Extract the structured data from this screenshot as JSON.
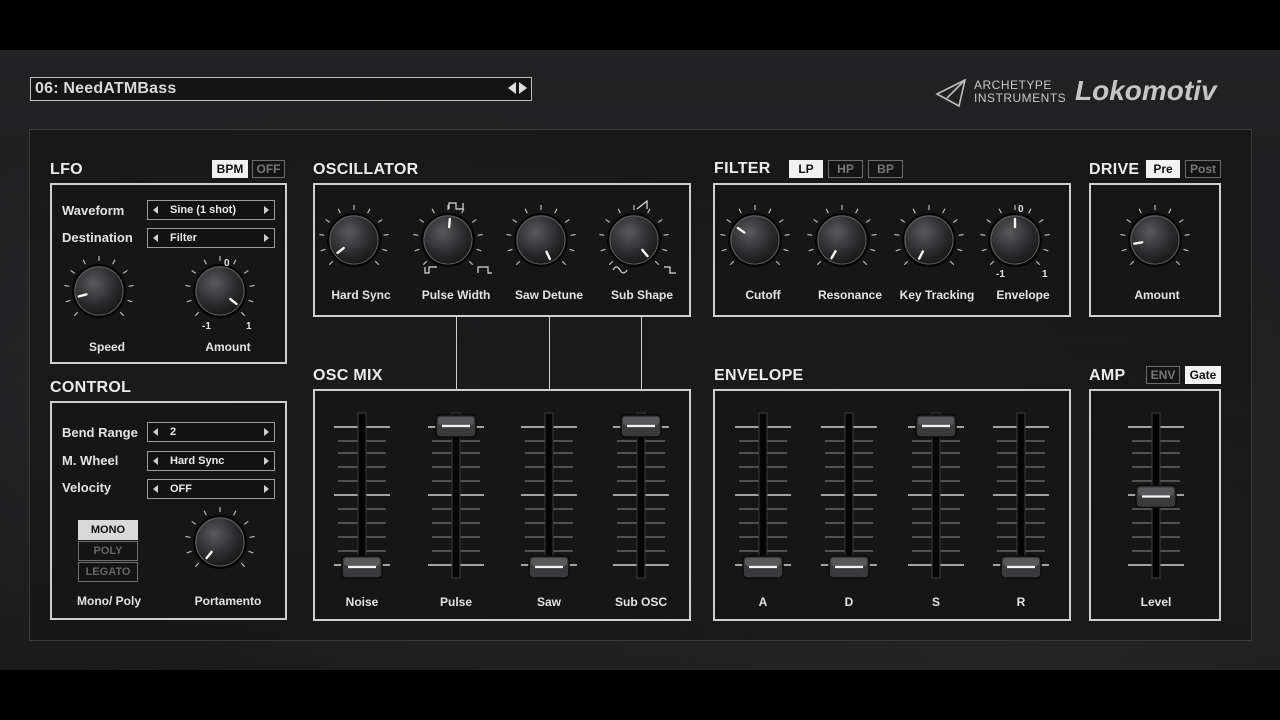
{
  "preset": {
    "name": "06: NeedATMBass"
  },
  "brand": {
    "line1": "ARCHETYPE",
    "line2": "INSTRUMENTS",
    "product": "Lokomotiv"
  },
  "lfo": {
    "title": "LFO",
    "toggles": [
      "BPM",
      "OFF"
    ],
    "waveform_label": "Waveform",
    "waveform_value": "Sine (1 shot)",
    "destination_label": "Destination",
    "destination_value": "Filter",
    "speed_label": "Speed",
    "amount_label": "Amount",
    "amount_top": "0",
    "amount_min": "-1",
    "amount_max": "1"
  },
  "control": {
    "title": "CONTROL",
    "bend_label": "Bend Range",
    "bend_value": "2",
    "wheel_label": "M. Wheel",
    "wheel_value": "Hard Sync",
    "velocity_label": "Velocity",
    "velocity_value": "OFF",
    "modes": [
      "MONO",
      "POLY",
      "LEGATO"
    ],
    "mono_poly_label": "Mono/ Poly",
    "portamento_label": "Portamento"
  },
  "oscillator": {
    "title": "OSCILLATOR",
    "knobs": [
      "Hard Sync",
      "Pulse Width",
      "Saw Detune",
      "Sub Shape"
    ]
  },
  "filter": {
    "title": "FILTER",
    "toggles": [
      "LP",
      "HP",
      "BP"
    ],
    "knobs": [
      "Cutoff",
      "Resonance",
      "Key Tracking",
      "Envelope"
    ],
    "env_top": "0",
    "env_min": "-1",
    "env_max": "1"
  },
  "drive": {
    "title": "DRIVE",
    "toggles": [
      "Pre",
      "Post"
    ],
    "amount_label": "Amount"
  },
  "osc_mix": {
    "title": "OSC MIX",
    "faders": [
      "Noise",
      "Pulse",
      "Saw",
      "Sub OSC"
    ]
  },
  "envelope": {
    "title": "ENVELOPE",
    "faders": [
      "A",
      "D",
      "S",
      "R"
    ]
  },
  "amp": {
    "title": "AMP",
    "toggles": [
      "ENV",
      "Gate"
    ],
    "level_label": "Level"
  }
}
